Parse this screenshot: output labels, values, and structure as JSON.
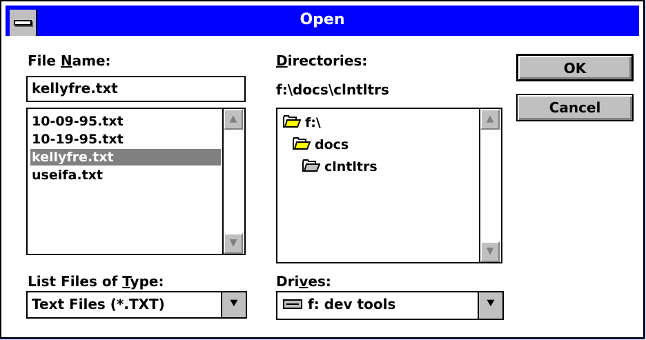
{
  "window": {
    "title": "Open"
  },
  "file_name": {
    "label_prefix": "File ",
    "label_accel": "N",
    "label_suffix": "ame:",
    "value": "kellyfre.txt",
    "files": [
      {
        "name": "10-09-95.txt",
        "selected": false
      },
      {
        "name": "10-19-95.txt",
        "selected": false
      },
      {
        "name": "kellyfre.txt",
        "selected": true
      },
      {
        "name": "useifa.txt",
        "selected": false
      }
    ]
  },
  "directories": {
    "label_accel": "D",
    "label_suffix": "irectories:",
    "current_path": "f:\\docs\\clntltrs",
    "tree": [
      {
        "name": "f:\\",
        "level": 0,
        "open": true
      },
      {
        "name": "docs",
        "level": 1,
        "open": true
      },
      {
        "name": "clntltrs",
        "level": 2,
        "open": true,
        "current": true
      }
    ]
  },
  "file_type": {
    "label_prefix": "List Files of ",
    "label_accel": "T",
    "label_suffix": "ype:",
    "selected": "Text Files (*.TXT)"
  },
  "drives": {
    "label_prefix": "Dri",
    "label_accel": "v",
    "label_suffix": "es:",
    "selected": "f: dev tools"
  },
  "buttons": {
    "ok": "OK",
    "cancel": "Cancel"
  },
  "icons": {
    "scroll_up": "▲",
    "scroll_down": "▼",
    "dropdown": "⯆"
  }
}
